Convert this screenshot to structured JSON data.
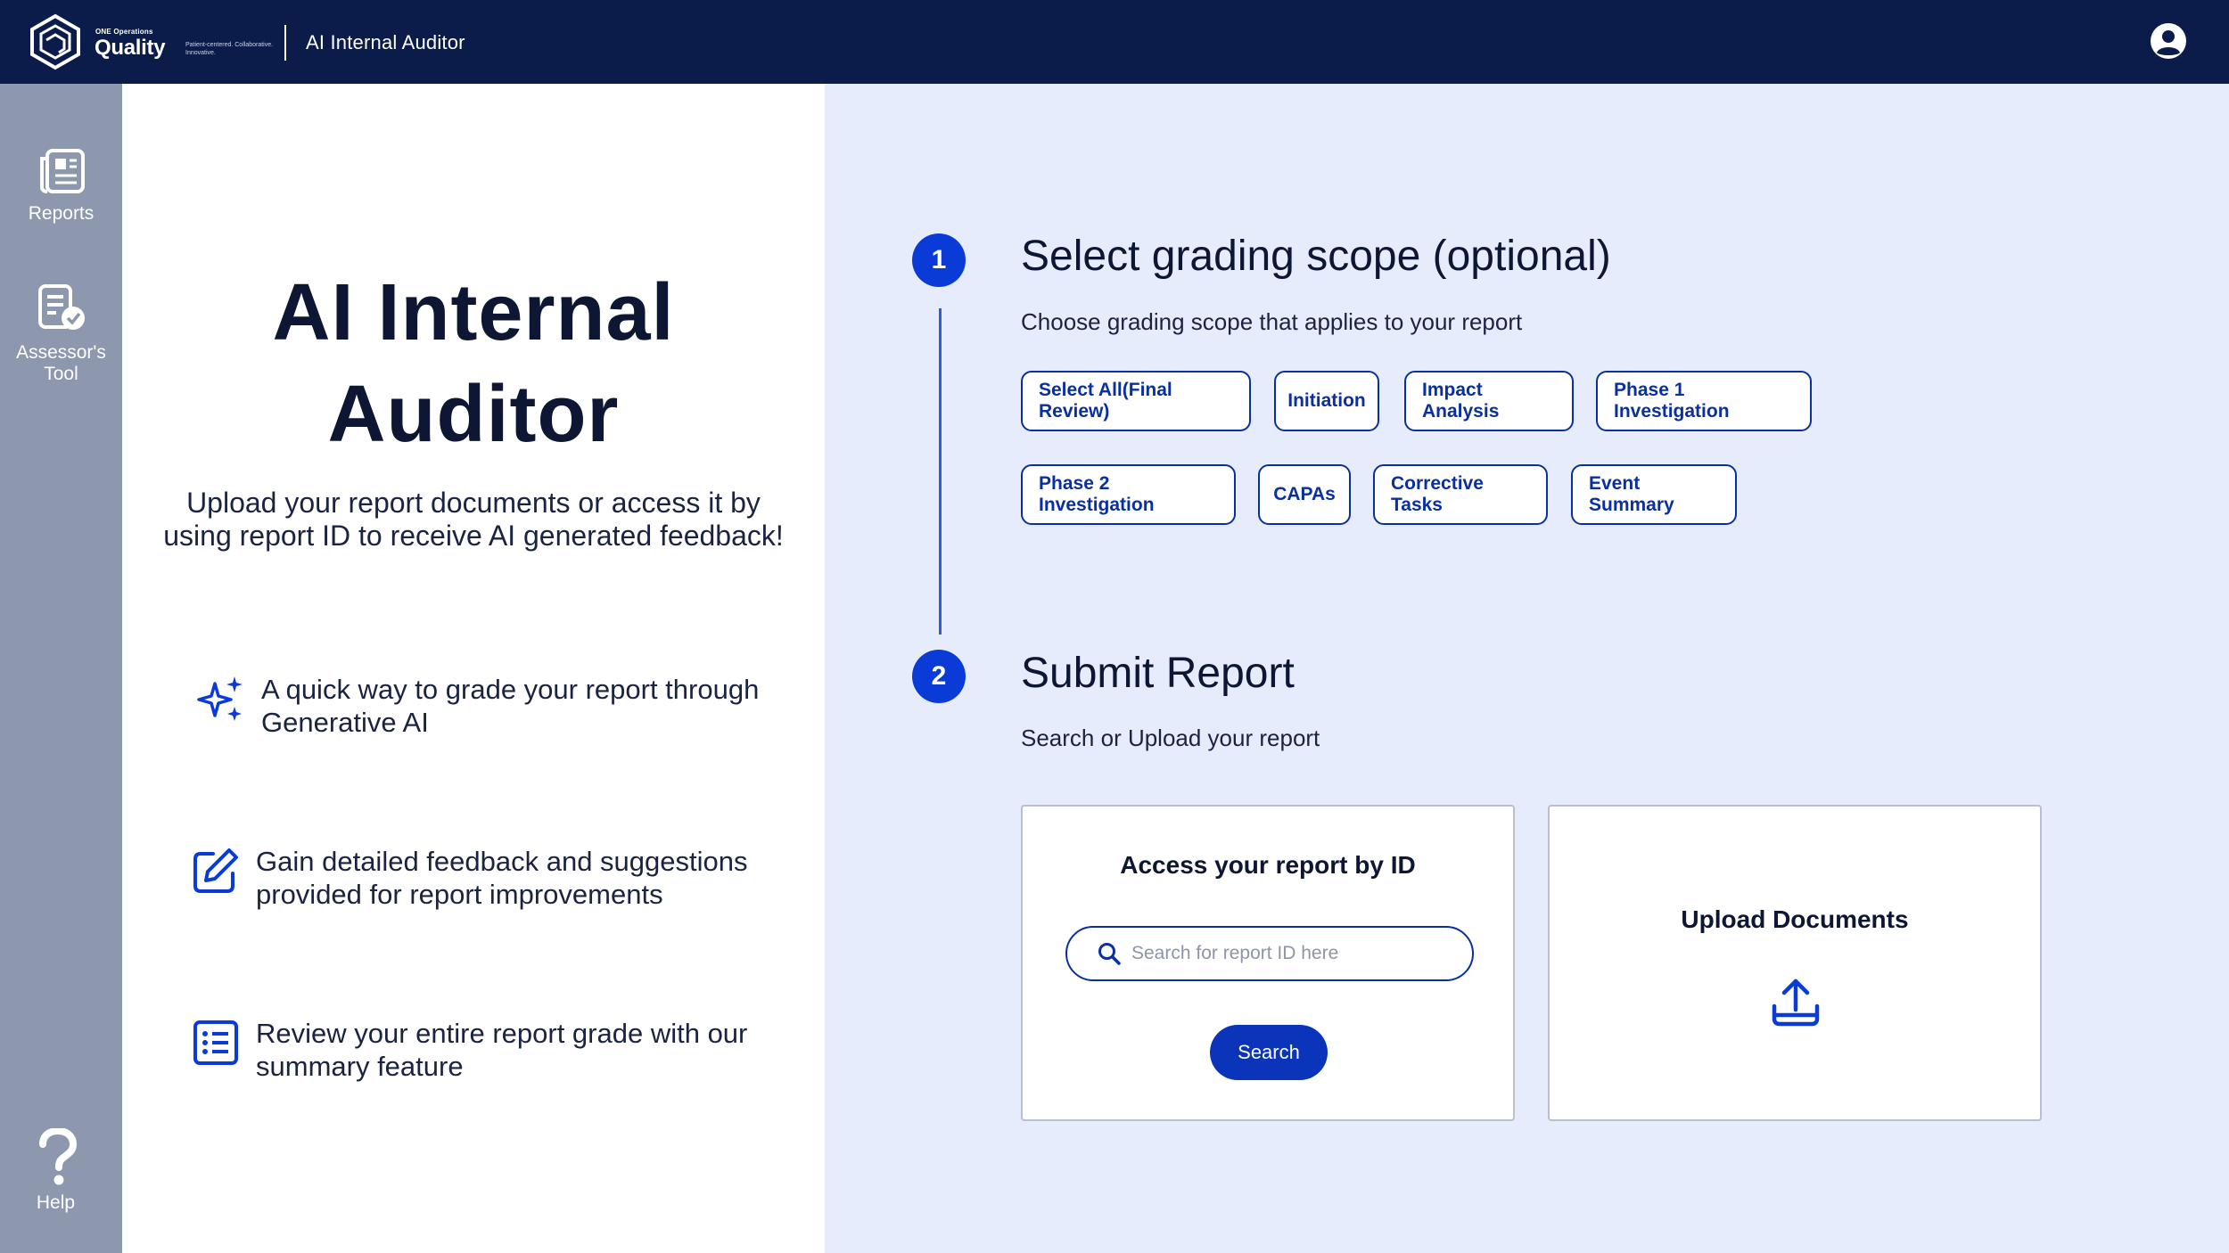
{
  "header": {
    "logo_small": "ONE Operations",
    "logo_word": "Quality",
    "logo_tagline": "Patient-centered. Collaborative. Innovative.",
    "app_title": "AI Internal Auditor"
  },
  "sidebar": {
    "items": [
      {
        "label": "Reports"
      },
      {
        "label": "Assessor's Tool"
      },
      {
        "label": "Help"
      }
    ]
  },
  "intro": {
    "title": "AI Internal Auditor",
    "subtitle": "Upload your report documents or access it by using report ID to receive AI generated feedback!",
    "features": [
      {
        "icon": "sparkles-icon",
        "text": "A quick way to grade your report through Generative AI"
      },
      {
        "icon": "edit-icon",
        "text": "Gain detailed feedback and suggestions provided for report improvements"
      },
      {
        "icon": "list-icon",
        "text": "Review your entire report grade with our summary feature"
      }
    ]
  },
  "steps": {
    "step1": {
      "number": "1",
      "title": "Select grading scope (optional)",
      "description": "Choose grading scope that applies to your report",
      "chips": [
        "Select All(Final Review)",
        "Initiation",
        "Impact Analysis",
        "Phase 1 Investigation",
        "Phase 2 Investigation",
        "CAPAs",
        "Corrective Tasks",
        "Event Summary"
      ]
    },
    "step2": {
      "number": "2",
      "title": "Submit Report",
      "description": "Search or Upload your report",
      "access_card": {
        "title": "Access your report by ID",
        "search_placeholder": "Search for report ID here",
        "search_value": "",
        "button_label": "Search"
      },
      "upload_card": {
        "title": "Upload Documents"
      }
    }
  },
  "colors": {
    "header_bg": "#0b1c4a",
    "rail_bg": "#8d97ae",
    "accent": "#0a3bd6",
    "chip_border": "#0a2f9e",
    "page_bg": "#e6ecfb"
  }
}
